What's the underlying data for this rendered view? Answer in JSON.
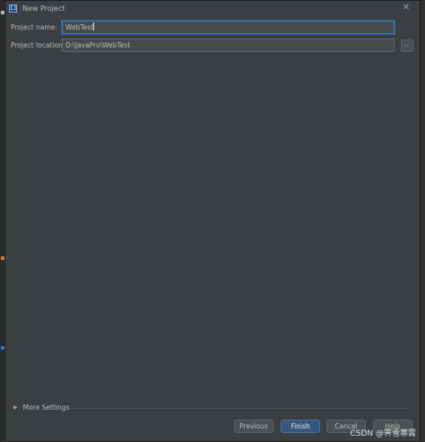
{
  "window": {
    "title": "New Project",
    "logo_text": "IJ",
    "close_glyph": "✕"
  },
  "form": {
    "project_name_label": "Project name:",
    "project_name_value": "WebTest",
    "project_location_label": "Project location:",
    "project_location_value": "D:\\JavaPro\\WebTest",
    "browse_label": "..."
  },
  "more_settings": {
    "arrow_glyph": "▶",
    "label": "More Settings"
  },
  "buttons": {
    "previous": "Previous",
    "finish": "Finish",
    "cancel": "Cancel",
    "help": "Help"
  },
  "watermark": "CSDN @霁雪寒霄",
  "colors": {
    "accent": "#365880",
    "focus": "#3d7bc0",
    "dialog_bg": "#3c3f41"
  }
}
